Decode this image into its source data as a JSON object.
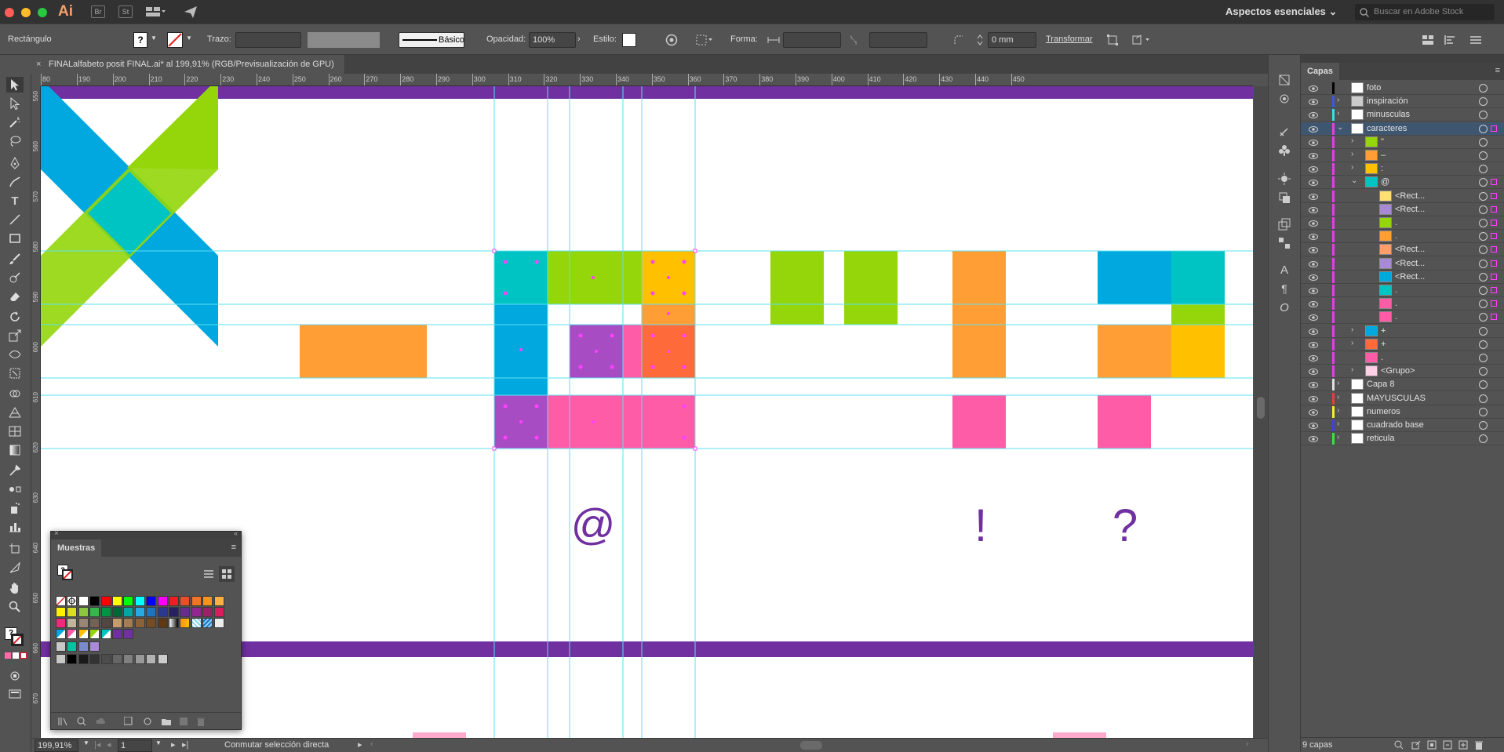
{
  "app": {
    "logo": "Ai",
    "bridge": "Br",
    "stock_btn": "St",
    "workspace": "Aspectos esenciales",
    "stock_search_placeholder": "Buscar en Adobe Stock"
  },
  "control": {
    "object": "Rectángulo",
    "fill_q": "?",
    "stroke_label": "Trazo:",
    "brush": "Básico",
    "opacity_label": "Opacidad:",
    "opacity": "100%",
    "style_label": "Estilo:",
    "shape_label": "Forma:",
    "radius": "0 mm",
    "transform": "Transformar"
  },
  "document": {
    "tab_title": "FINALalfabeto posit FINAL.ai* al 199,91% (RGB/Previsualización de GPU)"
  },
  "ruler": {
    "ticks": [
      "80",
      "190",
      "200",
      "210",
      "220",
      "230",
      "240",
      "250",
      "260",
      "270",
      "280",
      "290",
      "300",
      "310",
      "320",
      "330",
      "340",
      "350",
      "360",
      "370",
      "380",
      "390",
      "400",
      "410",
      "420",
      "430",
      "440",
      "450"
    ],
    "vticks": [
      "550",
      "560",
      "570",
      "580",
      "590",
      "600",
      "610",
      "620",
      "630",
      "640",
      "650",
      "660",
      "670"
    ]
  },
  "canvas": {
    "glyphs": [
      "@",
      "!",
      "?"
    ]
  },
  "swatches": {
    "title": "Muestras",
    "q": "?"
  },
  "layers": {
    "title": "Capas",
    "count": "9 capas",
    "rows": [
      {
        "name": "foto",
        "bar": "#000000",
        "exp": false,
        "lvl": 0
      },
      {
        "name": "inspiración",
        "bar": "#3d58d6",
        "exp": true,
        "lvl": 0
      },
      {
        "name": "minusculas",
        "bar": "#3be0e0",
        "exp": true,
        "lvl": 0
      },
      {
        "name": "caracteres",
        "bar": "#e040e0",
        "exp": true,
        "open": true,
        "lvl": 0
      },
      {
        "name": "\"",
        "bar": "#e040e0",
        "exp": true,
        "lvl": 1
      },
      {
        "name": "–",
        "bar": "#e040e0",
        "exp": true,
        "lvl": 1
      },
      {
        "name": ":",
        "bar": "#e040e0",
        "exp": true,
        "lvl": 1
      },
      {
        "name": "@",
        "bar": "#e040e0",
        "exp": true,
        "open": true,
        "lvl": 1
      },
      {
        "name": "<Rect...",
        "bar": "#e040e0",
        "lvl": 2
      },
      {
        "name": "<Rect...",
        "bar": "#e040e0",
        "lvl": 2
      },
      {
        "name": ".",
        "bar": "#e040e0",
        "lvl": 2
      },
      {
        "name": ".",
        "bar": "#e040e0",
        "lvl": 2
      },
      {
        "name": "<Rect...",
        "bar": "#e040e0",
        "lvl": 2
      },
      {
        "name": "<Rect...",
        "bar": "#e040e0",
        "lvl": 2
      },
      {
        "name": "<Rect...",
        "bar": "#e040e0",
        "lvl": 2
      },
      {
        "name": ".",
        "bar": "#e040e0",
        "lvl": 2
      },
      {
        "name": ".",
        "bar": "#e040e0",
        "lvl": 2
      },
      {
        "name": ".",
        "bar": "#e040e0",
        "lvl": 2
      },
      {
        "name": "+",
        "bar": "#e040e0",
        "exp": true,
        "lvl": 1
      },
      {
        "name": "+",
        "bar": "#e040e0",
        "exp": true,
        "lvl": 1
      },
      {
        "name": ".",
        "bar": "#e040e0",
        "lvl": 1
      },
      {
        "name": "<Grupo>",
        "bar": "#e040e0",
        "exp": true,
        "lvl": 1
      },
      {
        "name": "Capa 8",
        "bar": "#e0e0e0",
        "exp": true,
        "lvl": 0
      },
      {
        "name": "MAYUSCULAS",
        "bar": "#e04040",
        "exp": true,
        "lvl": 0
      },
      {
        "name": "numeros",
        "bar": "#f0f030",
        "exp": true,
        "lvl": 0
      },
      {
        "name": "cuadrado base",
        "bar": "#4040e0",
        "exp": true,
        "lvl": 0
      },
      {
        "name": "reticula",
        "bar": "#40e040",
        "exp": true,
        "lvl": 0
      }
    ]
  },
  "status": {
    "zoom": "199,91%",
    "artboard": "1",
    "message": "Conmutar selección directa"
  },
  "colors": {
    "purple": "#7030a0",
    "cyan": "#00c4c4",
    "blue": "#00a8e0",
    "green": "#94d60a",
    "yellow": "#ffc000",
    "orange": "#ff9e35",
    "magenta": "#a84cc4",
    "pink": "#ff5ca8",
    "red": "#ff6a3a",
    "guide": "#5ee0f0"
  }
}
